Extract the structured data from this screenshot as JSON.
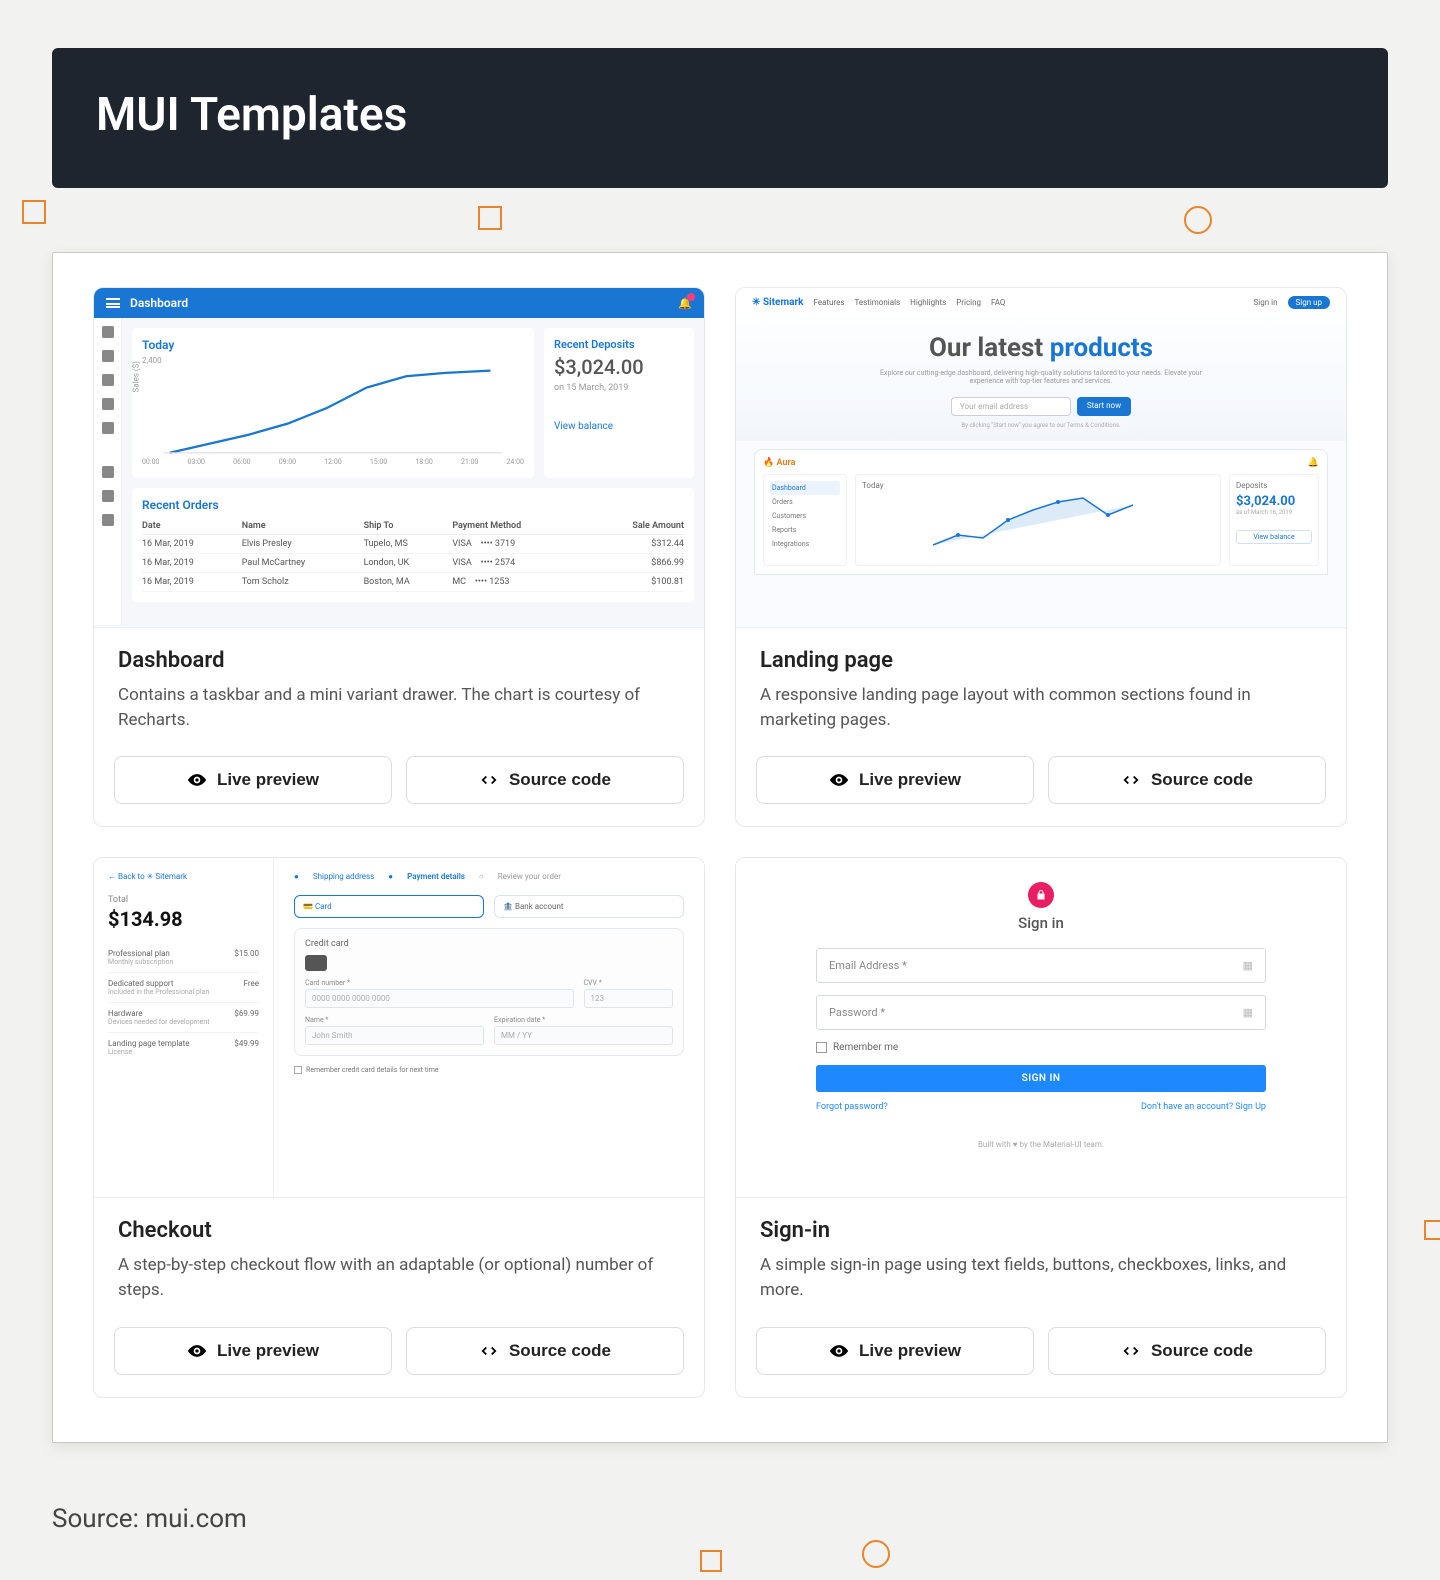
{
  "header": {
    "title": "MUI Templates"
  },
  "source_line": "Source: mui.com",
  "buttons": {
    "live": "Live preview",
    "code": "Source code"
  },
  "cards": {
    "dashboard": {
      "title": "Dashboard",
      "desc": "Contains a taskbar and a mini variant drawer. The chart is courtesy of Recharts.",
      "thumb": {
        "appbar_title": "Dashboard",
        "chart_title": "Today",
        "chart_ylabel": "Sales ($)",
        "chart_ytick": "2,400",
        "chart_xticks": [
          "00:00",
          "03:00",
          "06:00",
          "09:00",
          "12:00",
          "15:00",
          "18:00",
          "21:00",
          "24:00"
        ],
        "deposits": {
          "title": "Recent Deposits",
          "amount": "$3,024.00",
          "date": "on 15 March, 2019",
          "link": "View balance"
        },
        "orders": {
          "title": "Recent Orders",
          "cols": [
            "Date",
            "Name",
            "Ship To",
            "Payment Method",
            "Sale Amount"
          ],
          "rows": [
            [
              "16 Mar, 2019",
              "Elvis Presley",
              "Tupelo, MS",
              "VISA ⠀•••• 3719",
              "$312.44"
            ],
            [
              "16 Mar, 2019",
              "Paul McCartney",
              "London, UK",
              "VISA ⠀•••• 2574",
              "$866.99"
            ],
            [
              "16 Mar, 2019",
              "Tom Scholz",
              "Boston, MA",
              "MC ⠀•••• 1253",
              "$100.81"
            ]
          ]
        }
      }
    },
    "landing": {
      "title": "Landing page",
      "desc": "A responsive landing page layout with common sections found in marketing pages.",
      "thumb": {
        "brand": "✳ Sitemark",
        "nav": [
          "Features",
          "Testimonials",
          "Highlights",
          "Pricing",
          "FAQ"
        ],
        "nav_signin": "Sign in",
        "nav_signup": "Sign up",
        "hero_h1a": "Our latest ",
        "hero_h1b": "products",
        "hero_p": "Explore our cutting-edge dashboard, delivering high-quality solutions tailored to your needs. Elevate your experience with top-tier features and services.",
        "hero_input": "Your email address",
        "hero_btn": "Start now",
        "hero_fine": "By clicking \"Start now\" you agree to our Terms & Conditions.",
        "dash_brand": "🔥 Aura",
        "side": [
          "Dashboard",
          "Orders",
          "Customers",
          "Reports",
          "Integrations"
        ],
        "mini_chart_title": "Today",
        "mini_deposits": {
          "title": "Deposits",
          "amount": "$3,024.00",
          "date": "as of March 16, 2019",
          "btn": "View balance"
        }
      }
    },
    "checkout": {
      "title": "Checkout",
      "desc": "A step-by-step checkout flow with an adaptable (or optional) number of steps.",
      "thumb": {
        "back": "← Back to ✳ Sitemark",
        "total_label": "Total",
        "total": "$134.98",
        "items": [
          {
            "name": "Professional plan",
            "sub": "Monthly subscription",
            "price": "$15.00"
          },
          {
            "name": "Dedicated support",
            "sub": "Included in the Professional plan",
            "price": "Free"
          },
          {
            "name": "Hardware",
            "sub": "Devices needed for development",
            "price": "$69.99"
          },
          {
            "name": "Landing page template",
            "sub": "License",
            "price": "$49.99"
          }
        ],
        "steps": [
          "Shipping address",
          "Payment details",
          "Review your order"
        ],
        "tab_card": "Card",
        "tab_bank": "Bank account",
        "cc_title": "Credit card",
        "f_cardnum": "Card number *",
        "f_cardnum_ph": "0000 0000 0000 0000",
        "f_cvv": "CVV *",
        "f_cvv_ph": "123",
        "f_name": "Name *",
        "f_name_ph": "John Smith",
        "f_exp": "Expiration date *",
        "f_exp_ph": "MM / YY",
        "remember": "Remember credit card details for next time"
      }
    },
    "signin": {
      "title": "Sign-in",
      "desc": "A simple sign-in page using text fields, buttons, checkboxes, links, and more.",
      "thumb": {
        "heading": "Sign in",
        "email": "Email Address *",
        "password": "Password *",
        "remember": "Remember me",
        "btn": "SIGN IN",
        "forgot": "Forgot password?",
        "noacct": "Don't have an account? Sign Up",
        "foot": "Built with ♥ by the Material-UI team."
      }
    }
  },
  "chart_data": {
    "type": "line",
    "title": "Today",
    "ylabel": "Sales ($)",
    "x": [
      "00:00",
      "03:00",
      "06:00",
      "09:00",
      "12:00",
      "15:00",
      "18:00",
      "21:00",
      "24:00"
    ],
    "values": [
      0,
      300,
      600,
      900,
      1400,
      2000,
      2350,
      2450,
      2500
    ],
    "ylim": [
      0,
      2600
    ]
  }
}
